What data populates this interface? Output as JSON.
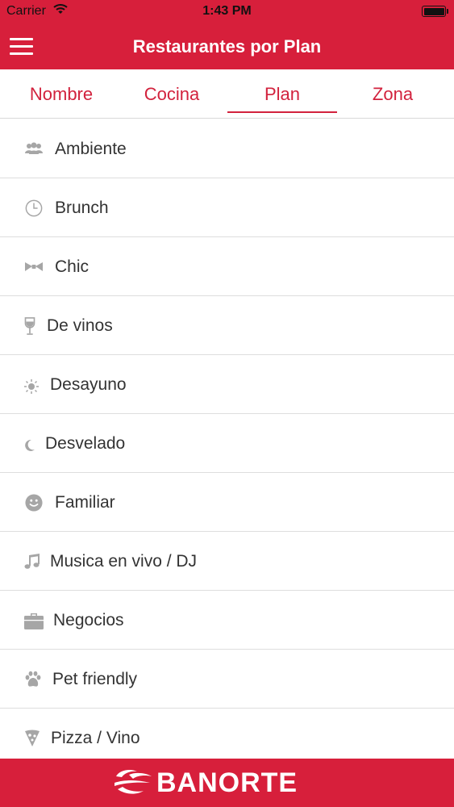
{
  "status_bar": {
    "carrier": "Carrier",
    "time": "1:43 PM",
    "wifi_icon": "wifi-icon",
    "battery_level": 1.0
  },
  "header": {
    "title": "Restaurantes por Plan",
    "menu_icon": "hamburger-menu-icon"
  },
  "tabs": [
    {
      "label": "Nombre",
      "active": false
    },
    {
      "label": "Cocina",
      "active": false
    },
    {
      "label": "Plan",
      "active": true
    },
    {
      "label": "Zona",
      "active": false
    }
  ],
  "plans": [
    {
      "label": "Ambiente",
      "icon": "people-icon"
    },
    {
      "label": "Brunch",
      "icon": "clock-icon"
    },
    {
      "label": "Chic",
      "icon": "bow-tie-icon"
    },
    {
      "label": "De vinos",
      "icon": "wine-glass-icon"
    },
    {
      "label": "Desayuno",
      "icon": "sun-icon"
    },
    {
      "label": "Desvelado",
      "icon": "moon-icon"
    },
    {
      "label": "Familiar",
      "icon": "smiley-icon"
    },
    {
      "label": "Musica en vivo / DJ",
      "icon": "music-note-icon"
    },
    {
      "label": "Negocios",
      "icon": "briefcase-icon"
    },
    {
      "label": "Pet friendly",
      "icon": "paw-icon"
    },
    {
      "label": "Pizza / Vino",
      "icon": "pizza-slice-icon"
    }
  ],
  "footer": {
    "brand": "BANORTE",
    "logo_icon": "banorte-logo-icon"
  },
  "colors": {
    "brand_red": "#d71f3b",
    "tab_text": "#d2223d",
    "icon_gray": "#a6a6a6",
    "item_text": "#333333"
  }
}
